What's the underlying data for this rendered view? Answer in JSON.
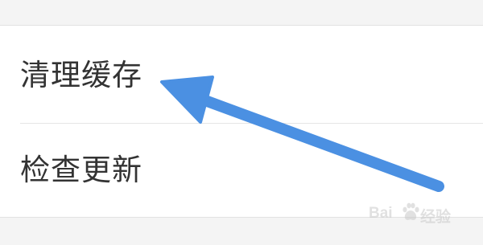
{
  "settings": {
    "items": [
      {
        "label": "清理缓存"
      },
      {
        "label": "检查更新"
      }
    ]
  },
  "annotation": {
    "arrow_icon": "pointer-arrow",
    "arrow_color": "#4b90e2"
  },
  "watermark": {
    "brand_left": "Bai",
    "paw_icon": "baidu-paw-icon",
    "brand_right": "经验"
  },
  "colors": {
    "background": "#ffffff",
    "band": "#f4f4f4",
    "text": "#333333",
    "divider": "#e5e5e5"
  }
}
